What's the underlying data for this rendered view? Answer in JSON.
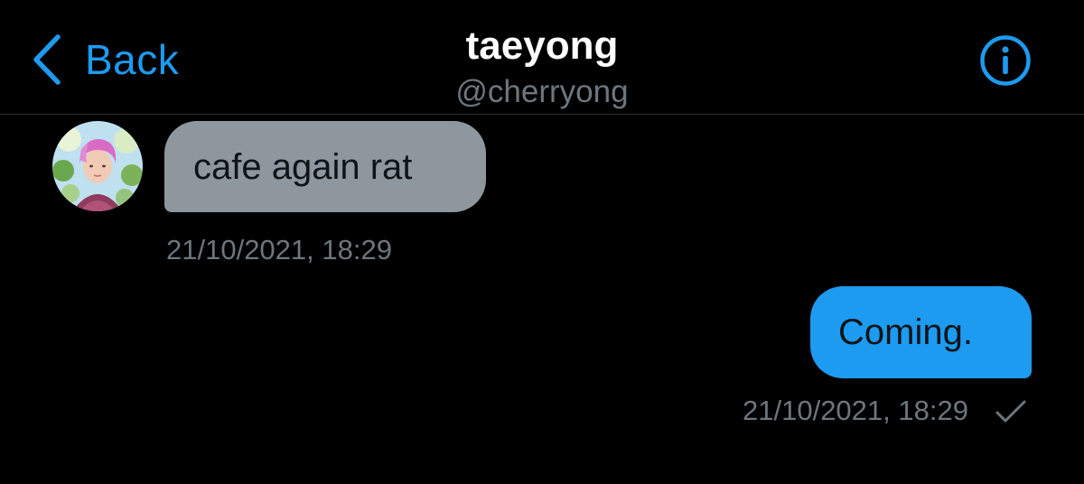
{
  "header": {
    "back_label": "Back",
    "contact_name": "taeyong",
    "contact_handle": "@cherryong",
    "info_icon": "info-circle-icon"
  },
  "colors": {
    "accent": "#1d9bf0",
    "background": "#000000",
    "incoming_bubble": "#8f979e",
    "secondary_text": "#6e767d",
    "divider": "#2f3336"
  },
  "messages": [
    {
      "direction": "incoming",
      "text": "cafe again rat",
      "timestamp": "21/10/2021, 18:29",
      "avatar": "profile-photo"
    },
    {
      "direction": "outgoing",
      "text": "Coming.",
      "timestamp": "21/10/2021, 18:29",
      "status_icon": "checkmark-icon"
    }
  ]
}
